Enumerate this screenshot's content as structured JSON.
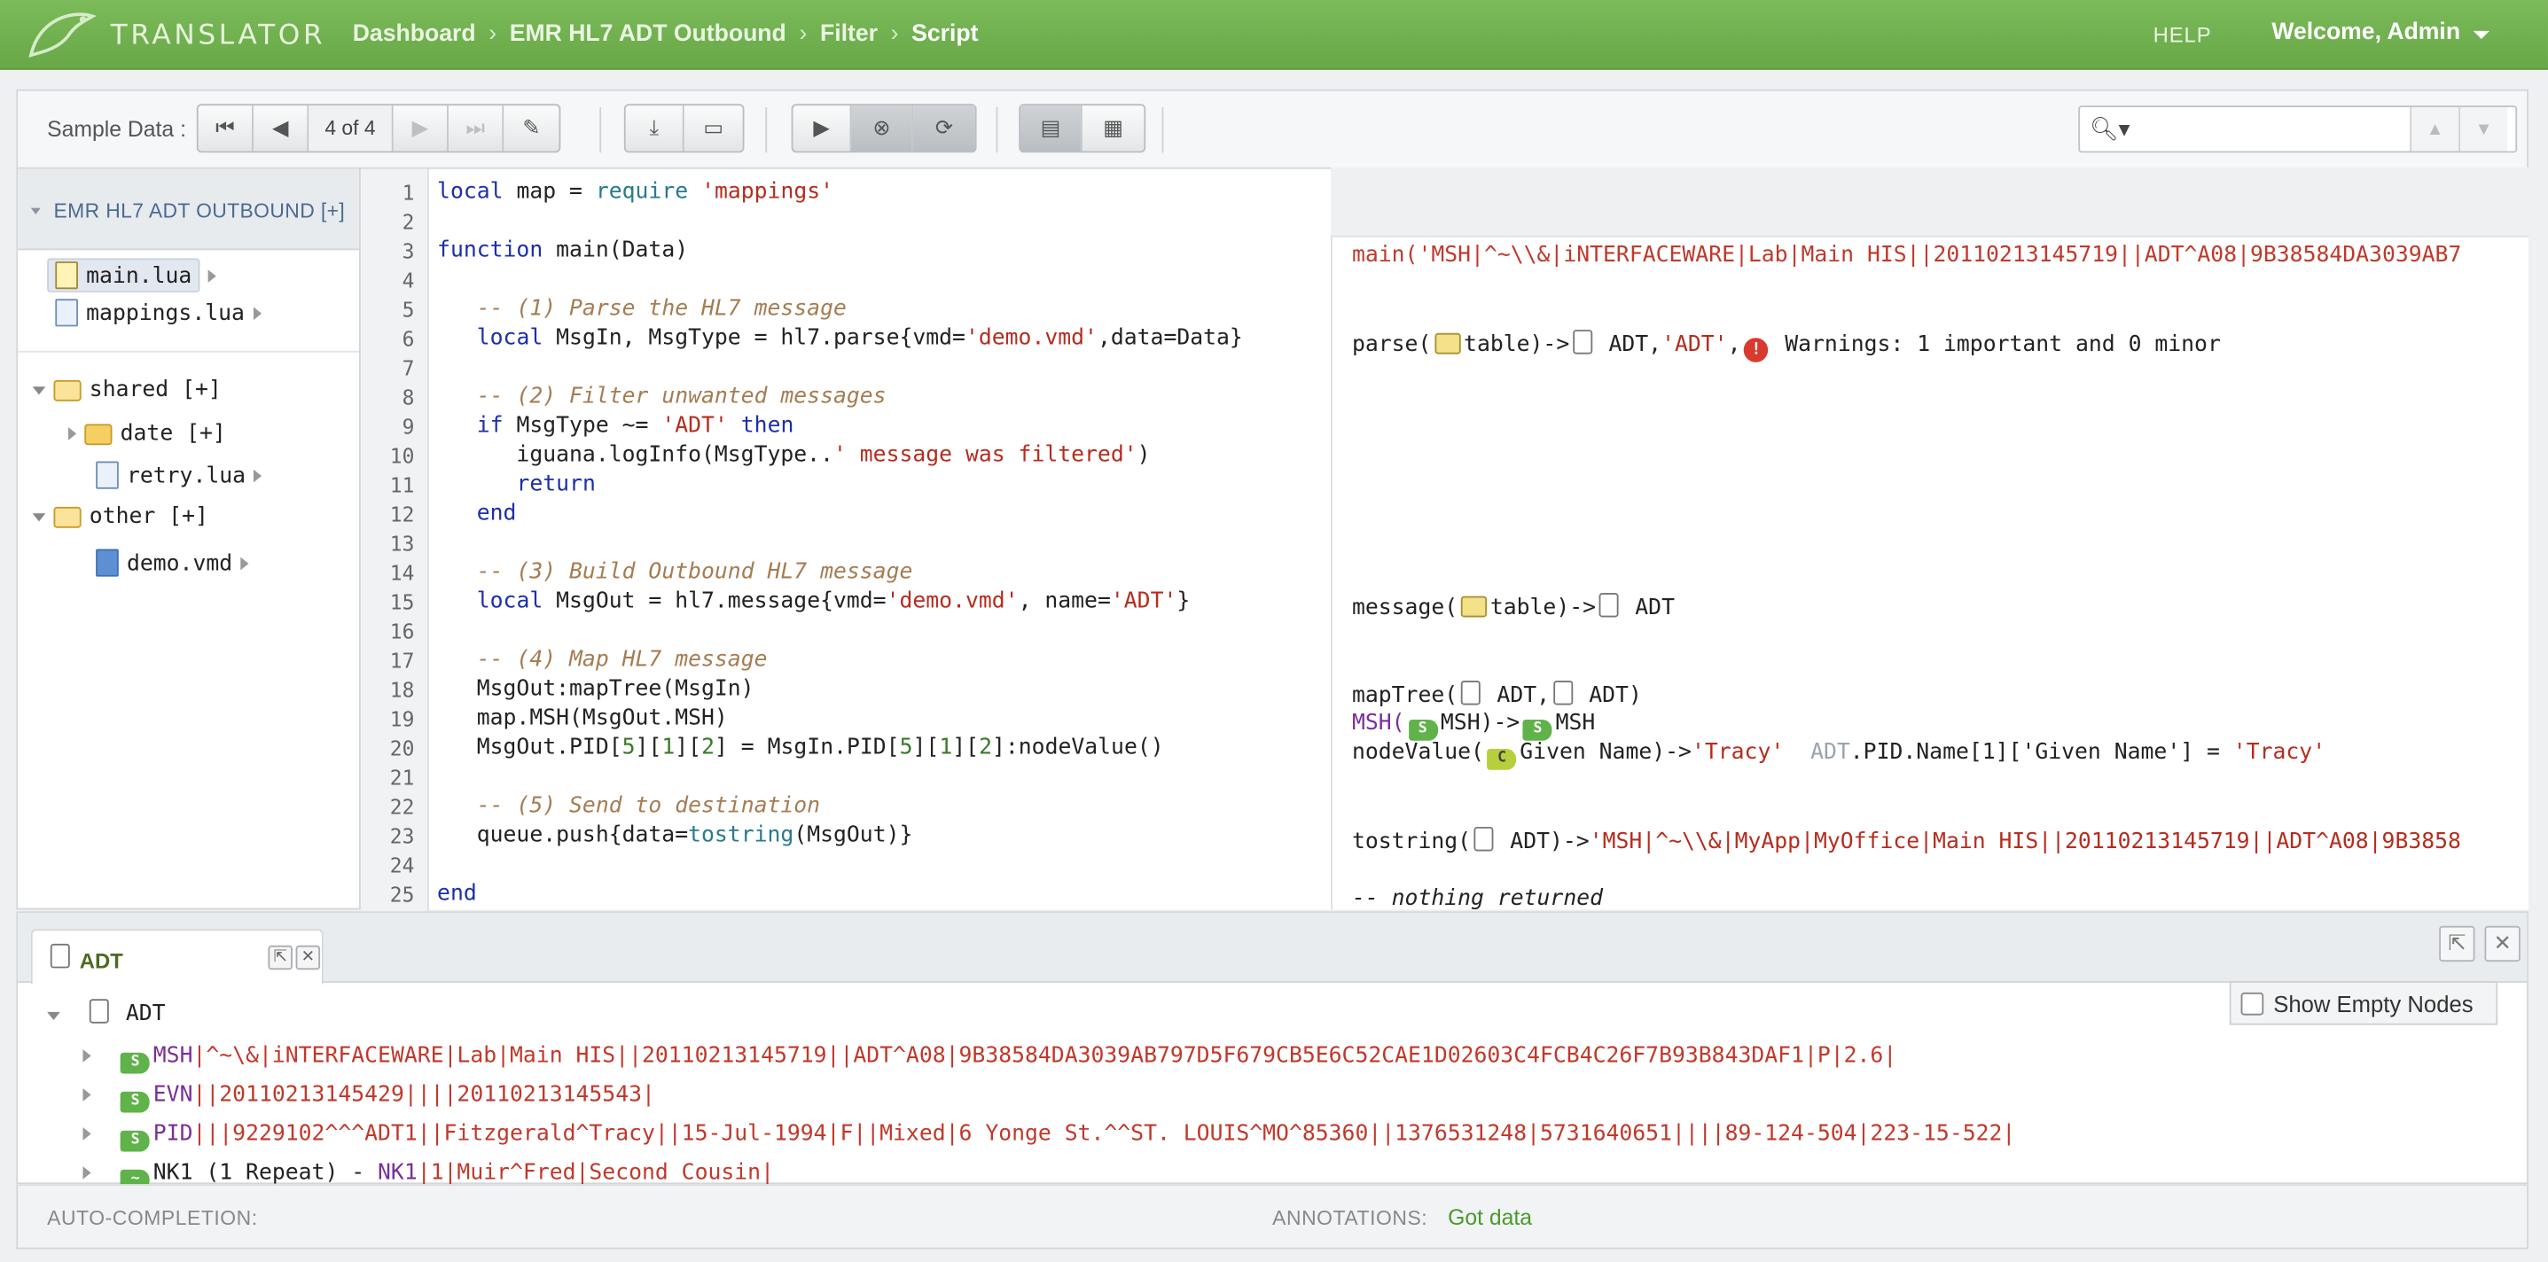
{
  "header": {
    "brand": "TRANSLATOR",
    "breadcrumbs": [
      "Dashboard",
      "EMR HL7 ADT Outbound",
      "Filter",
      "Script"
    ],
    "help": "HELP",
    "welcome": "Welcome, Admin"
  },
  "toolbar": {
    "sample_label": "Sample Data :",
    "page": "4 of 4",
    "search_placeholder": ""
  },
  "sidebar": {
    "project": "EMR HL7 ADT OUTBOUND [+]",
    "files": [
      "main.lua",
      "mappings.lua"
    ],
    "shared": "shared [+]",
    "date": "date [+]",
    "retry": "retry.lua",
    "other": "other [+]",
    "demo": "demo.vmd"
  },
  "editor": {
    "line_numbers": [
      "1",
      "2",
      "3",
      "4",
      "5",
      "6",
      "7",
      "8",
      "9",
      "10",
      "11",
      "12",
      "13",
      "14",
      "15",
      "16",
      "17",
      "18",
      "19",
      "20",
      "21",
      "22",
      "23",
      "24",
      "25"
    ]
  },
  "annotations": {
    "main_call": "main('MSH|^~\\\\&|iNTERFACEWARE|Lab|Main HIS||20110213145719||ADT^A08|9B38584DA3039AB7",
    "parse": "parse(",
    "parse_mid": "table)->",
    "parse_adt": "ADT,",
    "parse_str": "'ADT'",
    "parse_warn": "Warnings: 1 important and 0 minor",
    "message": "message(",
    "message_mid": "table)->",
    "message_adt": "ADT",
    "maptree": "mapTree(",
    "maptree_a": "ADT,",
    "maptree_b": "ADT)",
    "msh_fn": "MSH(",
    "msh_a": "MSH)->",
    "msh_b": "MSH",
    "nodevalue": "nodeValue(",
    "nodevalue_mid": "Given Name)->",
    "nodevalue_val": "'Tracy'",
    "nodevalue_gray": "ADT",
    "nodevalue_path": ".PID.Name[1]['Given Name'] = ",
    "nodevalue_val2": "'Tracy'",
    "tostring": "tostring(",
    "tostring_mid": "ADT)->",
    "tostring_val": "'MSH|^~\\\\&|MyApp|MyOffice|Main HIS||20110213145719||ADT^A08|9B3858",
    "nothing": "-- nothing returned"
  },
  "bottom": {
    "tab": "ADT",
    "root": "ADT",
    "show_empty": "Show Empty Nodes",
    "msh_seg": "MSH",
    "msh_rest": "|^~\\&|iNTERFACEWARE|Lab|Main HIS||20110213145719||ADT^A08|9B38584DA3039AB797D5F679CB5E6C52CAE1D02603C4FCB4C26F7B93B843DAF1|P|2.6|",
    "evn_seg": "EVN",
    "evn_rest": "||20110213145429||||20110213145543|",
    "pid_seg": "PID",
    "pid_rest": "|||9229102^^^ADT1||Fitzgerald^Tracy||15-Jul-1994|F||Mixed|6 Yonge St.^^ST. LOUIS^MO^85360||1376531248|5731640651||||89-124-504|223-15-522|",
    "nk1_label": "NK1 (1 Repeat) - ",
    "nk1_seg": "NK1",
    "nk1_rest": "|1|Muir^Fred|Second Cousin|"
  },
  "status": {
    "autocomplete": "AUTO-COMPLETION:",
    "annotations": "ANNOTATIONS:",
    "annotations_value": "Got data"
  }
}
